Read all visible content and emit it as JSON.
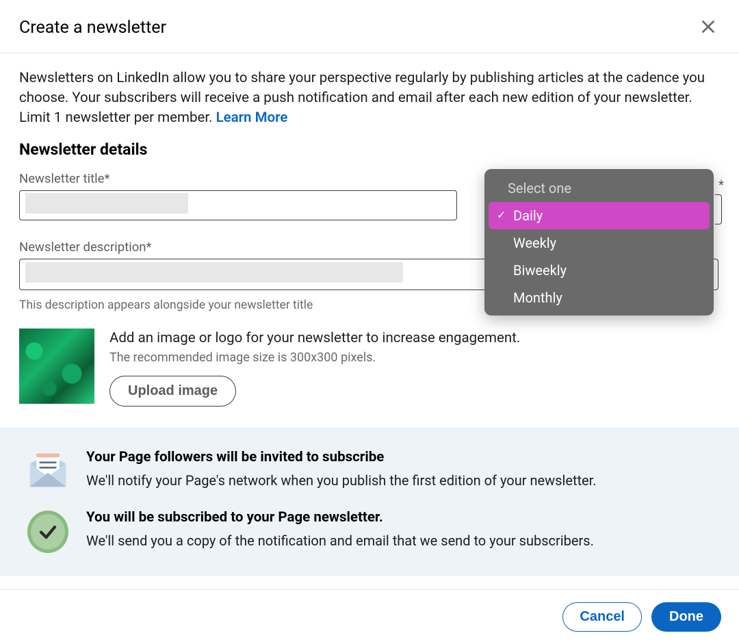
{
  "header": {
    "title": "Create a newsletter"
  },
  "intro": {
    "text_before_link": "Newsletters on LinkedIn allow you to share your perspective regularly by publishing articles at the cadence you choose. Your subscribers will receive a push notification and email after each new edition of your newsletter. Limit 1 newsletter per member. ",
    "learn_more_label": "Learn More"
  },
  "details": {
    "heading": "Newsletter details",
    "title_field": {
      "label": "Newsletter title*",
      "value": ""
    },
    "description_field": {
      "label": "Newsletter description*",
      "value": "",
      "helper": "This description appears alongside your newsletter title"
    },
    "upload": {
      "title": "Add an image or logo for your newsletter to increase engagement.",
      "subtitle": "The recommended image size is 300x300 pixels.",
      "button": "Upload image"
    }
  },
  "cadence": {
    "asterisk": "*",
    "header": "Select one",
    "options": [
      "Daily",
      "Weekly",
      "Biweekly",
      "Monthly"
    ],
    "selected_index": 0
  },
  "info": {
    "row1": {
      "title": "Your Page followers will be invited to subscribe",
      "text": "We'll notify your Page's network when you publish the first edition of your newsletter."
    },
    "row2": {
      "title": "You will be subscribed to your Page newsletter.",
      "text": "We'll send you a copy of the notification and email that we send to your subscribers."
    }
  },
  "footer": {
    "cancel": "Cancel",
    "done": "Done"
  }
}
